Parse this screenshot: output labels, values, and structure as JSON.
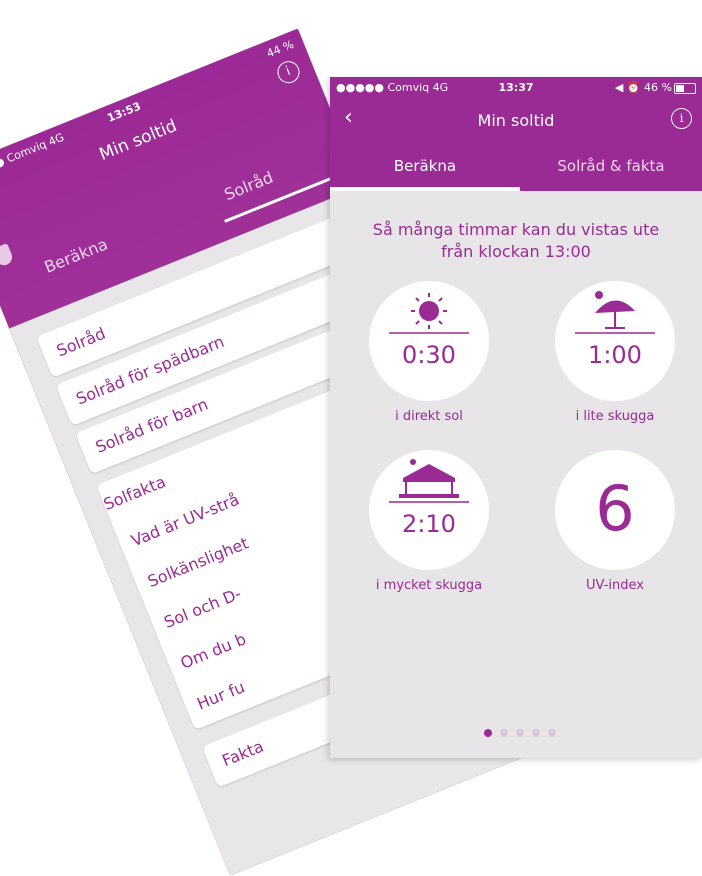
{
  "back_phone": {
    "status": {
      "carrier": "●●●●● Comviq  4G",
      "time": "13:53",
      "battery": "44 %"
    },
    "title": "Min soltid",
    "tabs": [
      "Beräkna",
      "Solråd"
    ],
    "cards": [
      "Solråd",
      "Solråd för spädbarn",
      "Solråd för barn"
    ],
    "fakta": {
      "title": "Solfakta",
      "items": [
        "Vad är UV-strå",
        "Solkänslighet",
        "Sol och D-",
        "Om du b",
        "Hur fu"
      ]
    },
    "last_card": "Fakta"
  },
  "status": {
    "carrier": "●●●●● Comviq  4G",
    "time": "13:37",
    "right": "◀ ⏰ 46 %"
  },
  "header": {
    "back_glyph": "‹",
    "title": "Min soltid",
    "info_glyph": "i"
  },
  "tabs": [
    {
      "label": "Beräkna",
      "active": true
    },
    {
      "label": "Solråd & fakta",
      "active": false
    }
  ],
  "main": {
    "heading_line1": "Så många timmar kan du vistas ute",
    "heading_line2": "från klockan 13:00",
    "tiles": [
      {
        "icon": "sun-icon",
        "value": "0:30",
        "label": "i direkt sol"
      },
      {
        "icon": "umbrella-icon",
        "value": "1:00",
        "label": "i lite skugga"
      },
      {
        "icon": "pavilion-icon",
        "value": "2:10",
        "label": "i mycket skugga"
      },
      {
        "icon": "uv-index",
        "value": "6",
        "label": "UV-index"
      }
    ]
  },
  "pager": {
    "count": 5,
    "active_index": 0
  },
  "colors": {
    "brand": "#9a2a94",
    "background": "#e8e5e8",
    "dot_inactive": "#d9c8d8"
  }
}
